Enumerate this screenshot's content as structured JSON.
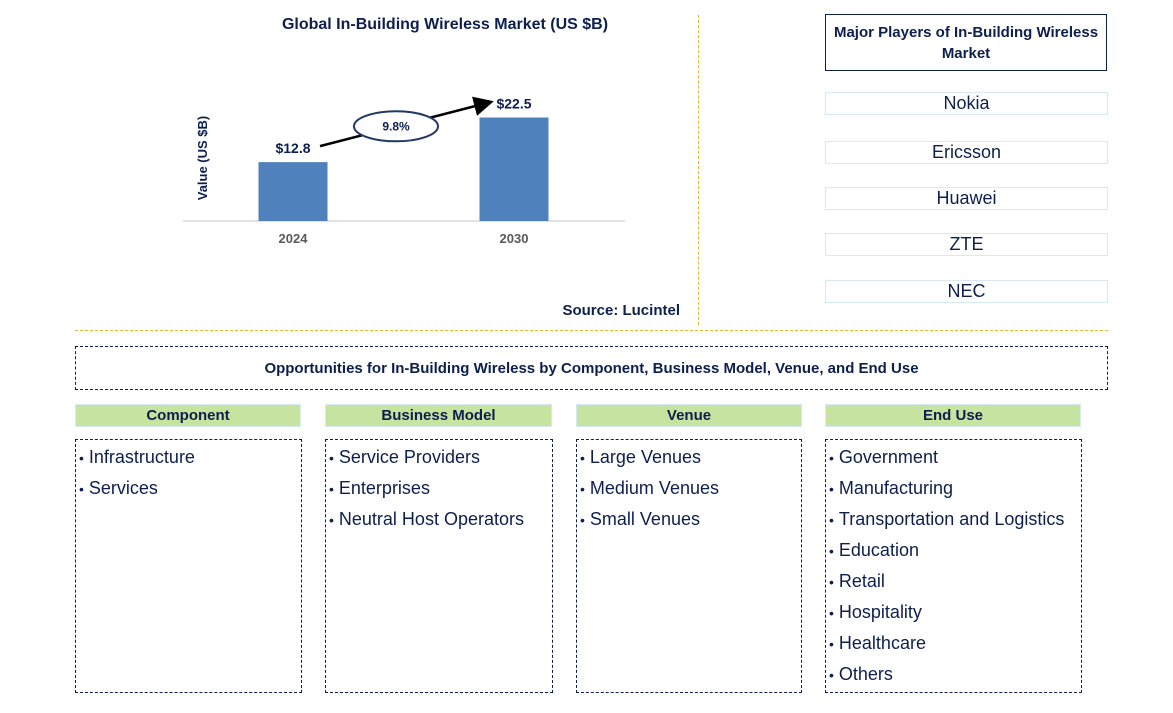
{
  "chart_data": {
    "type": "bar",
    "title": "Global In-Building Wireless Market (US $B)",
    "xlabel": "",
    "ylabel": "Value (US $B)",
    "categories": [
      "2024",
      "2030"
    ],
    "values": [
      12.8,
      22.5
    ],
    "data_labels": [
      "$12.8",
      "$22.5"
    ],
    "ylim": [
      0,
      25
    ],
    "grid": false,
    "bar_color": "#4f81bd",
    "annotation": {
      "type": "cagr-arrow",
      "label": "9.8%"
    }
  },
  "source": "Source: Lucintel",
  "players": {
    "title": "Major Players of In-Building Wireless Market",
    "items": [
      "Nokia",
      "Ericsson",
      "Huawei",
      "ZTE",
      "NEC"
    ]
  },
  "opportunities": {
    "title": "Opportunities for In-Building Wireless by Component, Business Model, Venue, and End Use",
    "categories": [
      {
        "header": "Component",
        "items": [
          "Infrastructure",
          "Services"
        ]
      },
      {
        "header": "Business Model",
        "items": [
          "Service Providers",
          "Enterprises",
          "Neutral Host Operators"
        ]
      },
      {
        "header": "Venue",
        "items": [
          "Large Venues",
          "Medium Venues",
          "Small Venues"
        ]
      },
      {
        "header": "End Use",
        "items": [
          "Government",
          "Manufacturing",
          "Transportation and Logistics",
          "Education",
          "Retail",
          "Hospitality",
          "Healthcare",
          "Others"
        ]
      }
    ]
  },
  "colors": {
    "text": "#0d1f4f",
    "bar": "#4f81bd",
    "header_fill": "#c6e3a0",
    "separator": "#f0b429"
  }
}
